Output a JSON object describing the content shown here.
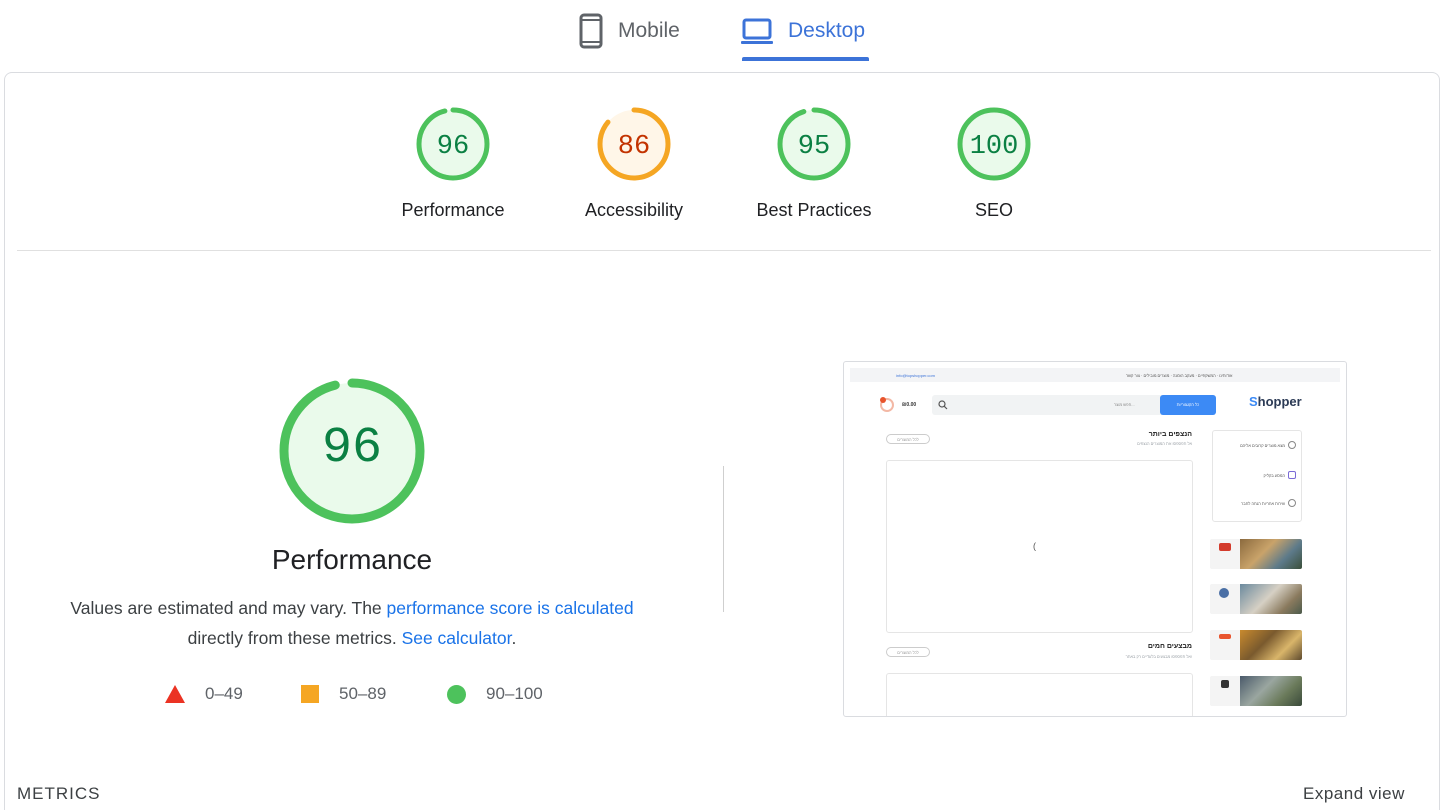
{
  "tabs": [
    {
      "label": "Mobile",
      "icon": "phone-icon",
      "selected": false
    },
    {
      "label": "Desktop",
      "icon": "laptop-icon",
      "selected": true
    }
  ],
  "categories": [
    {
      "label": "Performance",
      "score": "96",
      "value": 96,
      "status": "pass"
    },
    {
      "label": "Accessibility",
      "score": "86",
      "value": 86,
      "status": "average"
    },
    {
      "label": "Best Practices",
      "score": "95",
      "value": 95,
      "status": "pass"
    },
    {
      "label": "SEO",
      "score": "100",
      "value": 100,
      "status": "pass"
    }
  ],
  "colors": {
    "pass": "#0cce6b",
    "pass_ring": "#4dc25c",
    "pass_text": "#0b8043",
    "pass_bg": "#eafaeb",
    "average_ring": "#f5a623",
    "average_text": "#c33300",
    "average_bg": "#fff6e8",
    "fail": "#eb3323",
    "accent": "#3c73d8"
  },
  "performance": {
    "score": "96",
    "value": 96,
    "title": "Performance",
    "desc_prefix": "Values are estimated and may vary. The ",
    "desc_link": "performance score is calculated",
    "desc_middle": " directly from these metrics. ",
    "desc_link2": "See calculator",
    "desc_suffix": "."
  },
  "legend": [
    {
      "range": "0–49",
      "shape": "triangle"
    },
    {
      "range": "50–89",
      "shape": "square"
    },
    {
      "range": "90–100",
      "shape": "circle"
    }
  ],
  "metrics": {
    "heading": "METRICS",
    "expand": "Expand view"
  },
  "thumbnail": {
    "email": "info@topshopper.com",
    "nav": "אודותינו  ·  המשקפיים  ·  מעקב הזמנה  ·  מוצרים מובילים  ·  צור קשר",
    "price": "₪0.00",
    "search_placeholder": "חפש מוצר...",
    "search_button": "כל הקטגוריות",
    "logo_s": "S",
    "logo_rest": "hopper",
    "section1_title": "הנצפים ביותר",
    "section1_sub": "אל תפספסו את המוצרים הנצפים",
    "section2_title": "מבצעים חמים",
    "section2_sub": "אל תפספסו מבצעים בלעדיים רק באתר!",
    "pill": "לכל המוצרים",
    "side_items": [
      "מצא מוצרים קרובים אליהם",
      "המסע בקליק",
      "שירות אחריות הנחה לחבר"
    ]
  }
}
